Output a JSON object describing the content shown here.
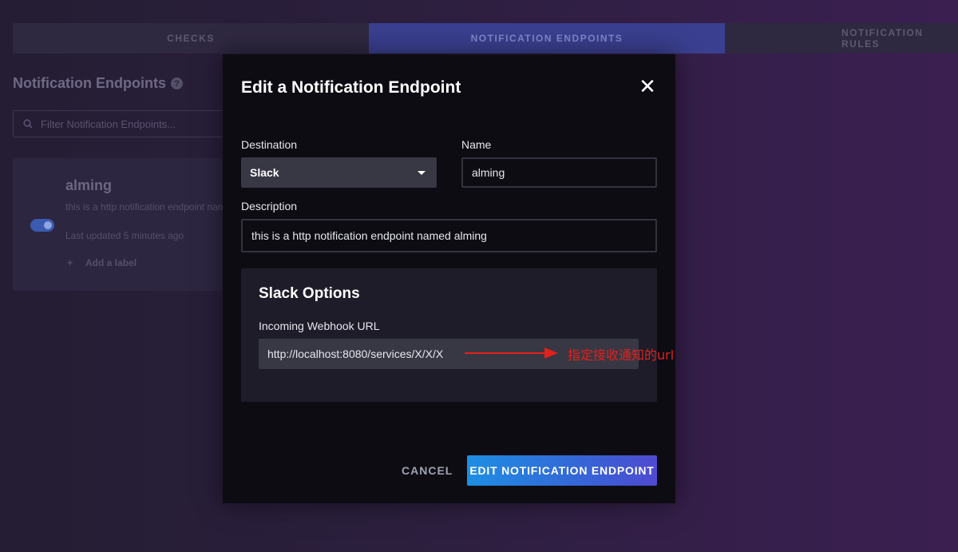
{
  "tabs": [
    {
      "label": "CHECKS"
    },
    {
      "label": "NOTIFICATION ENDPOINTS"
    },
    {
      "label": "NOTIFICATION RULES"
    }
  ],
  "page": {
    "title": "Notification Endpoints",
    "filter_placeholder": "Filter Notification Endpoints..."
  },
  "endpoint_card": {
    "name": "alming",
    "description": "this is a http notification endpoint named alming",
    "updated": "Last updated 5 minutes ago",
    "add_label": "Add a label",
    "enabled": true
  },
  "modal": {
    "title": "Edit a Notification Endpoint",
    "destination_label": "Destination",
    "destination_value": "Slack",
    "name_label": "Name",
    "name_value": "alming",
    "description_label": "Description",
    "description_value": "this is a http notification endpoint named alming",
    "slack_options_title": "Slack Options",
    "webhook_label": "Incoming Webhook URL",
    "webhook_value": "http://localhost:8080/services/X/X/X",
    "cancel_label": "CANCEL",
    "submit_label": "EDIT NOTIFICATION ENDPOINT"
  },
  "annotation": {
    "text": "指定接收通知的url",
    "color": "#e3201b"
  },
  "colors": {
    "accent": "#3565d6",
    "modal_bg": "#0d0c13"
  }
}
